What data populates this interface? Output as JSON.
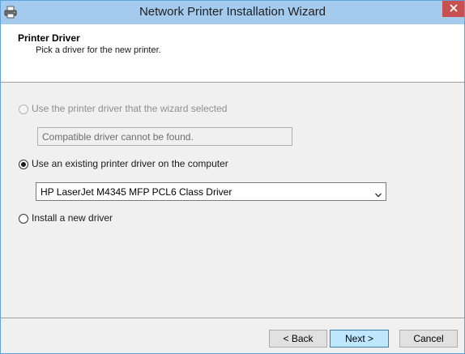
{
  "window": {
    "title": "Network Printer Installation Wizard",
    "icon": "printer-icon",
    "close_icon": "close-icon"
  },
  "header": {
    "title": "Printer Driver",
    "subtitle": "Pick a driver for the new printer."
  },
  "options": {
    "wizard_selected": {
      "label": "Use the printer driver that the wizard selected",
      "selected": false,
      "enabled": false,
      "info_text": "Compatible driver cannot be found."
    },
    "existing_driver": {
      "label": "Use an existing printer driver on the computer",
      "selected": true,
      "enabled": true,
      "driver_value": "HP LaserJet M4345 MFP PCL6 Class Driver"
    },
    "new_driver": {
      "label": "Install a new driver",
      "selected": false,
      "enabled": true
    }
  },
  "footer": {
    "back_label": "< Back",
    "next_label": "Next >",
    "cancel_label": "Cancel"
  },
  "colors": {
    "titlebar": "#a4cbee",
    "close_button": "#c75050",
    "default_button": "#bee6fd"
  }
}
